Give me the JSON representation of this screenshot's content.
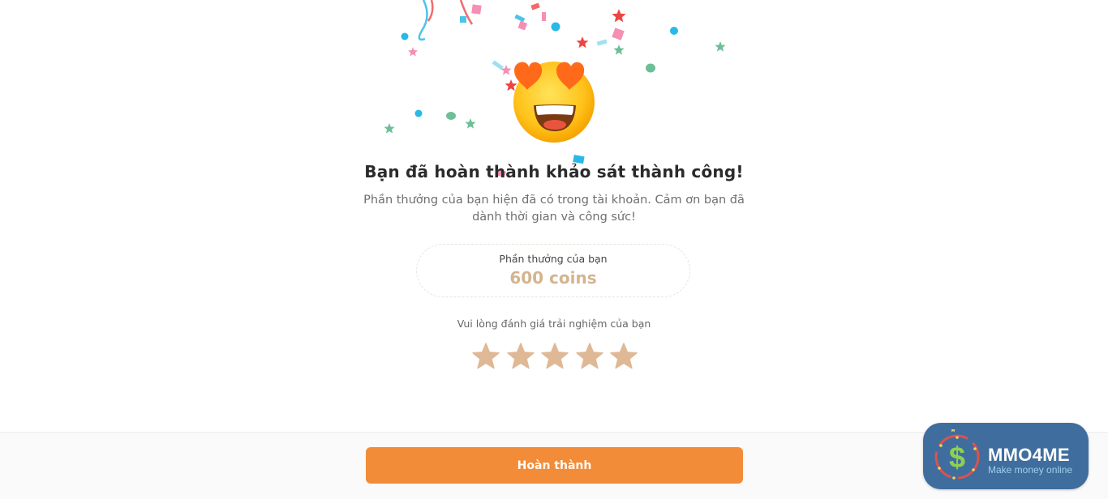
{
  "completion": {
    "title": "Bạn đã hoàn thành khảo sát thành công!",
    "message": "Phần thưởng của bạn hiện đã có trong tài khoản. Cảm ơn bạn đã dành thời gian và công sức!"
  },
  "reward": {
    "label": "Phần thưởng của bạn",
    "value": "600 coins"
  },
  "rating": {
    "prompt": "Vui lòng đánh giá trải nghiệm của bạn",
    "max_stars": 5,
    "selected": 0,
    "star_color": "#dfb896"
  },
  "footer": {
    "finish_label": "Hoàn thành"
  },
  "watermark": {
    "brand": "MMO4ME",
    "tagline": "Make money online"
  },
  "colors": {
    "accent": "#f28c38",
    "reward_value": "#d4b48f"
  }
}
